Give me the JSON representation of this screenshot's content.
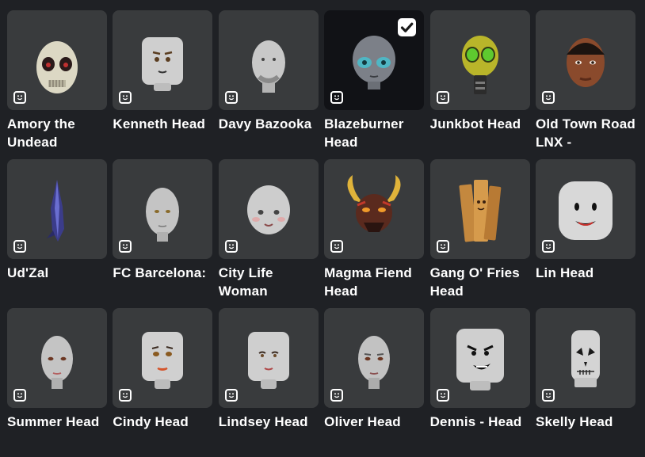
{
  "items": [
    {
      "name": "Amory the Undead",
      "selected": false,
      "art": "skull-mask-head"
    },
    {
      "name": "Kenneth Head",
      "selected": false,
      "art": "cylinder-head"
    },
    {
      "name": "Davy Bazooka",
      "selected": false,
      "art": "bald-man-head"
    },
    {
      "name": "Blazeburner Head",
      "selected": true,
      "art": "alien-head"
    },
    {
      "name": "Junkbot Head",
      "selected": false,
      "art": "robot-head"
    },
    {
      "name": "Old Town Road LNX -",
      "selected": false,
      "art": "realistic-man-head"
    },
    {
      "name": "Ud'Zal",
      "selected": false,
      "art": "crystal-head"
    },
    {
      "name": "FC Barcelona:",
      "selected": false,
      "art": "bald-head"
    },
    {
      "name": "City Life Woman",
      "selected": false,
      "art": "woman-head"
    },
    {
      "name": "Magma Fiend Head",
      "selected": false,
      "art": "horned-demon-head"
    },
    {
      "name": "Gang O' Fries Head",
      "selected": false,
      "art": "fries-head"
    },
    {
      "name": "Lin Head",
      "selected": false,
      "art": "classic-smile-head"
    },
    {
      "name": "Summer Head",
      "selected": false,
      "art": "female-head"
    },
    {
      "name": "Cindy Head",
      "selected": false,
      "art": "cylinder-lipstick-head"
    },
    {
      "name": "Lindsey Head",
      "selected": false,
      "art": "cylinder-woman-head"
    },
    {
      "name": "Oliver Head",
      "selected": false,
      "art": "male-head"
    },
    {
      "name": "Dennis - Head",
      "selected": false,
      "art": "cylinder-grin-head"
    },
    {
      "name": "Skelly Head",
      "selected": false,
      "art": "skull-head"
    }
  ],
  "type_icon": "head-type-icon",
  "selected_icon": "checkmark-icon"
}
